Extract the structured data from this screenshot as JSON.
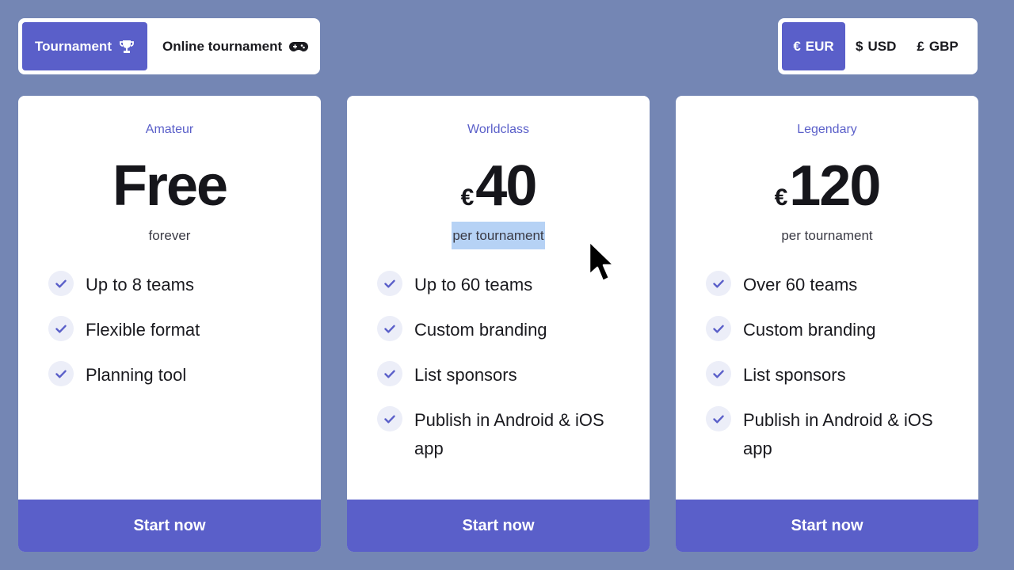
{
  "type_toggle": {
    "options": [
      {
        "label": "Tournament",
        "icon": "trophy-icon",
        "active": true
      },
      {
        "label": "Online tournament",
        "icon": "gamepad-icon",
        "active": false
      }
    ]
  },
  "currency_toggle": {
    "options": [
      {
        "symbol": "€",
        "label": "EUR",
        "active": true
      },
      {
        "symbol": "$",
        "label": "USD",
        "active": false
      },
      {
        "symbol": "£",
        "label": "GBP",
        "active": false
      }
    ]
  },
  "plans": [
    {
      "tier": "Amateur",
      "currency": "",
      "price": "Free",
      "period": "forever",
      "features": [
        "Up to 8 teams",
        "Flexible format",
        "Planning tool"
      ],
      "cta": "Start now"
    },
    {
      "tier": "Worldclass",
      "currency": "€",
      "price": "40",
      "period": "per tournament",
      "period_selected": true,
      "features": [
        "Up to 60 teams",
        "Custom branding",
        "List sponsors",
        "Publish in Android & iOS app"
      ],
      "cta": "Start now"
    },
    {
      "tier": "Legendary",
      "currency": "€",
      "price": "120",
      "period": "per tournament",
      "features": [
        "Over 60 teams",
        "Custom branding",
        "List sponsors",
        "Publish in Android & iOS app"
      ],
      "cta": "Start now"
    }
  ],
  "colors": {
    "background": "#7486b4",
    "accent": "#5a5fc9",
    "card": "#ffffff",
    "check_bg": "#eceef8",
    "selection": "#b6d2f5"
  }
}
